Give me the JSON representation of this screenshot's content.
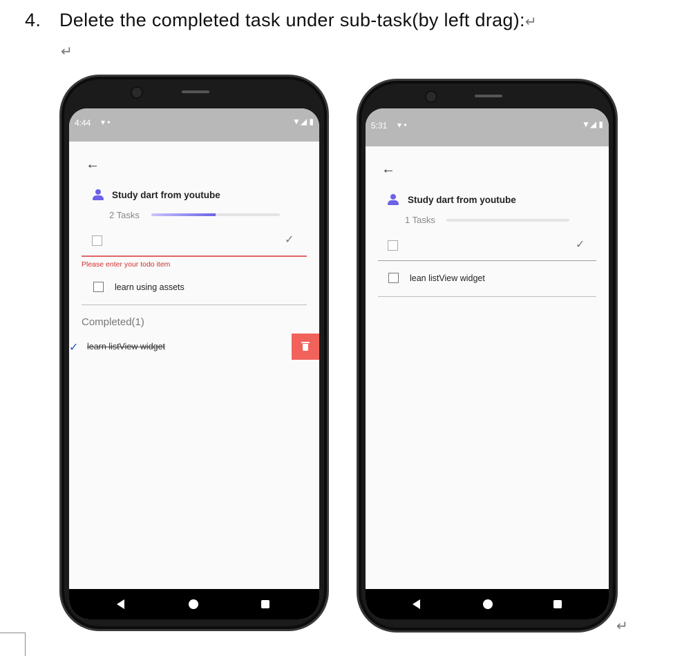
{
  "heading": {
    "number": "4.",
    "text": "Delete the completed task under sub-task(by left drag):",
    "return_mark": "↵"
  },
  "left_phone": {
    "status": {
      "time": "4:44",
      "icons_left": "▾ •",
      "icons_right": "▼◢ ▮"
    },
    "back_icon": "←",
    "title": "Study dart from youtube",
    "tasks_count": "2 Tasks",
    "progress": 0.5,
    "new_item_check": "✓",
    "error_text": "Please enter your todo item",
    "items": [
      {
        "label": "learn using assets"
      }
    ],
    "completed_header": "Completed(1)",
    "completed_items": [
      {
        "label": "learn listView widget"
      }
    ],
    "swipe_check": "✓"
  },
  "right_phone": {
    "status": {
      "time": "5:31",
      "icons_left": "▾ •",
      "icons_right": "▼◢ ▮"
    },
    "back_icon": "←",
    "title": "Study dart from youtube",
    "tasks_count": "1 Tasks",
    "progress": 0.0,
    "new_item_check": "✓",
    "items": [
      {
        "label": "lean listView widget"
      }
    ]
  },
  "colors": {
    "accent": "#6b62e8",
    "delete": "#f0625a",
    "error": "#d32f2f"
  }
}
